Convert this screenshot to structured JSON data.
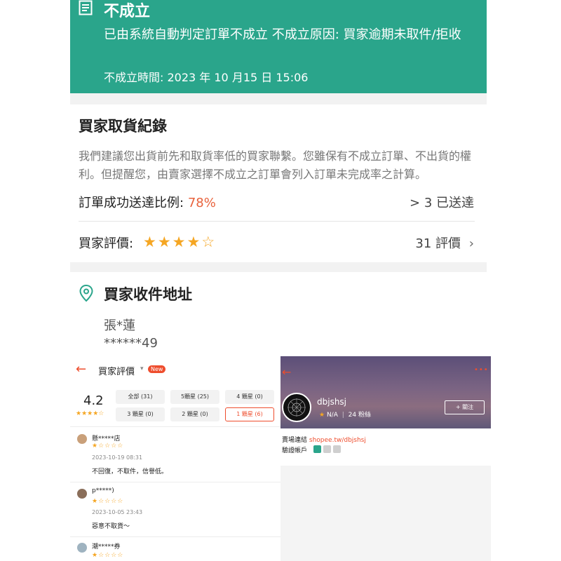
{
  "order": {
    "status_title": "不成立",
    "reason": "已由系統自動判定訂單不成立 不成立原因: 買家逾期未取件/拒收",
    "time": "不成立時間: 2023 年 10 月15 日 15:06",
    "accent_color": "#2aa58b"
  },
  "pickup_record": {
    "title": "買家取貨紀錄",
    "description": "我們建議您出貨前先和取貨率低的買家聯繫。您雖保有不成立訂單、不出貨的權利。但提醒您，由賣家選擇不成立之訂單會列入訂單未完成率之計算。",
    "success_rate_label": "訂單成功送達比例:",
    "success_rate_value": "78%",
    "delivered": "> 3 已送達",
    "buyer_rating_label": "買家評價:",
    "buyer_rating_stars": 4,
    "buyer_rating_max": 5,
    "review_count": "31 評價"
  },
  "address": {
    "title": "買家收件地址",
    "name": "張*蓮",
    "phone": "******49",
    "icon": "location-pin-icon"
  },
  "reviews_panel": {
    "back_icon": "back-arrow-icon",
    "title": "買家評價",
    "new_badge": "New",
    "average": "4.2",
    "average_stars": 4.2,
    "filters": [
      "全部 (31)",
      "5顆星 (25)",
      "4 顆星 (0)",
      "3 顆星 (0)",
      "2 顆星 (0)",
      "1 顆星 (6)"
    ],
    "active_filter": 5,
    "reviews": [
      {
        "name": "懸*****店",
        "stars": 1,
        "date": "2023-10-19 08:31",
        "text": "不回復，不取件，信譽低。"
      },
      {
        "name": "p*****)",
        "stars": 1,
        "date": "2023-10-05 23:43",
        "text": "惡意不取貨～"
      },
      {
        "name": "潮*****券",
        "stars": 1,
        "date": "",
        "text": ""
      }
    ]
  },
  "shop_panel": {
    "shop_name": "dbjshsj",
    "rating": "N/A",
    "followers": "24 粉絲",
    "follow_button": "+ 關注",
    "link_label": "賣場連結",
    "link_url": "shopee.tw/dbjshsj",
    "verify_label": "驗證帳戶",
    "brand_color": "#ee4d2d"
  }
}
